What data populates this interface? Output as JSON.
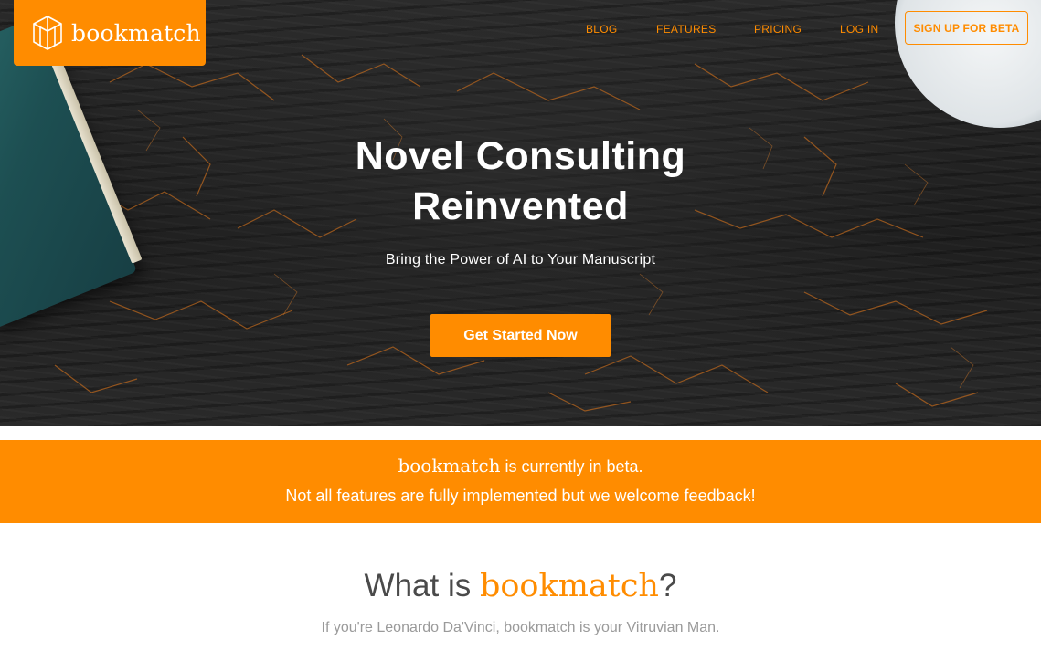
{
  "brand": {
    "name": "bookmatch",
    "accent_color": "#ff8c00",
    "logo_icon": "book-cube-icon"
  },
  "nav": {
    "items": [
      "BLOG",
      "FEATURES",
      "PRICING",
      "LOG IN"
    ],
    "signup_label": "SIGN UP FOR BETA"
  },
  "hero": {
    "title_line1": "Novel Consulting",
    "title_line2": "Reinvented",
    "subtitle": "Bring the Power of AI to Your Manuscript",
    "cta_label": "Get Started Now"
  },
  "beta_banner": {
    "brand": "bookmatch",
    "line1_rest": " is currently in beta.",
    "line2": "Not all features are fully implemented but we welcome feedback!"
  },
  "what_section": {
    "title_prefix": "What is ",
    "brand": "bookmatch",
    "title_suffix": "?",
    "subtitle": "If you're Leonardo Da'Vinci, bookmatch is your Vitruvian Man."
  }
}
